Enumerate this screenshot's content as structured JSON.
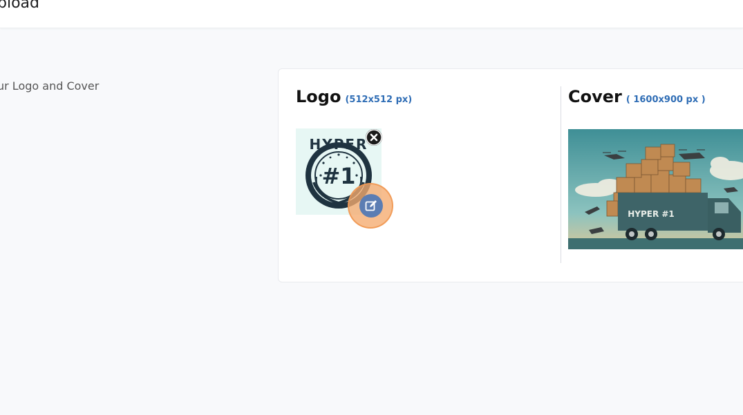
{
  "header": {
    "title": "pload"
  },
  "section": {
    "description": "ur Logo and Cover"
  },
  "logo": {
    "title": "Logo",
    "dimensions": "(512x512 px)",
    "image_text_top": "HYPER",
    "image_text_center": "#1",
    "remove_icon": "close-circle-icon",
    "edit_icon": "edit-square-icon"
  },
  "cover": {
    "title": "Cover",
    "dimensions": "( 1600x900 px )",
    "truck_label": "HYPER #1"
  }
}
